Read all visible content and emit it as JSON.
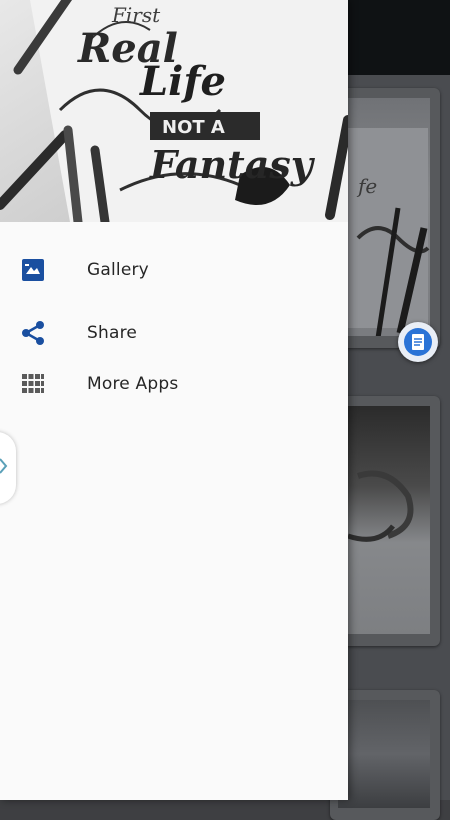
{
  "drawer": {
    "menu": [
      {
        "id": "gallery",
        "label": "Gallery",
        "icon": "image-icon"
      },
      {
        "id": "share",
        "label": "Share",
        "icon": "share-icon"
      },
      {
        "id": "more-apps",
        "label": "More Apps",
        "icon": "grid-icon"
      }
    ],
    "header_image": {
      "lettering": [
        "First",
        "Real",
        "Life",
        "NOT A",
        "Fantasy"
      ]
    }
  },
  "colors": {
    "accent": "#1a4fa0",
    "drawer_bg": "#fafafa",
    "text": "#262626"
  }
}
